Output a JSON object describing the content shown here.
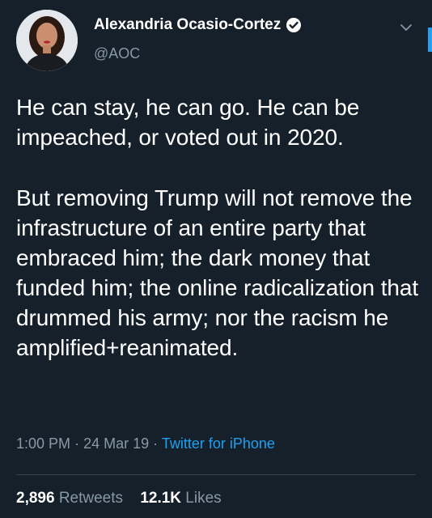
{
  "author": {
    "display_name": "Alexandria Ocasio-Cortez",
    "handle": "@AOC",
    "verified": true,
    "avatar_icon": "profile-photo",
    "verified_icon": "verified-badge-icon"
  },
  "tweet": {
    "paragraphs": [
      "He can stay, he can go. He can be impeached, or voted out in 2020.",
      "But removing Trump will not remove the infrastructure of an entire party that embraced him; the dark money that funded him; the online radicalization that drummed his army; nor the racism he amplified+reanimated."
    ]
  },
  "meta": {
    "time": "1:00 PM",
    "separator": "·",
    "date": "24 Mar 19",
    "source": "Twitter for iPhone"
  },
  "stats": {
    "retweets_count": "2,896",
    "retweets_label": "Retweets",
    "likes_count": "12.1K",
    "likes_label": "Likes"
  },
  "colors": {
    "background": "#15202b",
    "text": "#ffffff",
    "secondary_text": "#8899a6",
    "accent": "#1da1f2",
    "divider": "#38444d"
  }
}
